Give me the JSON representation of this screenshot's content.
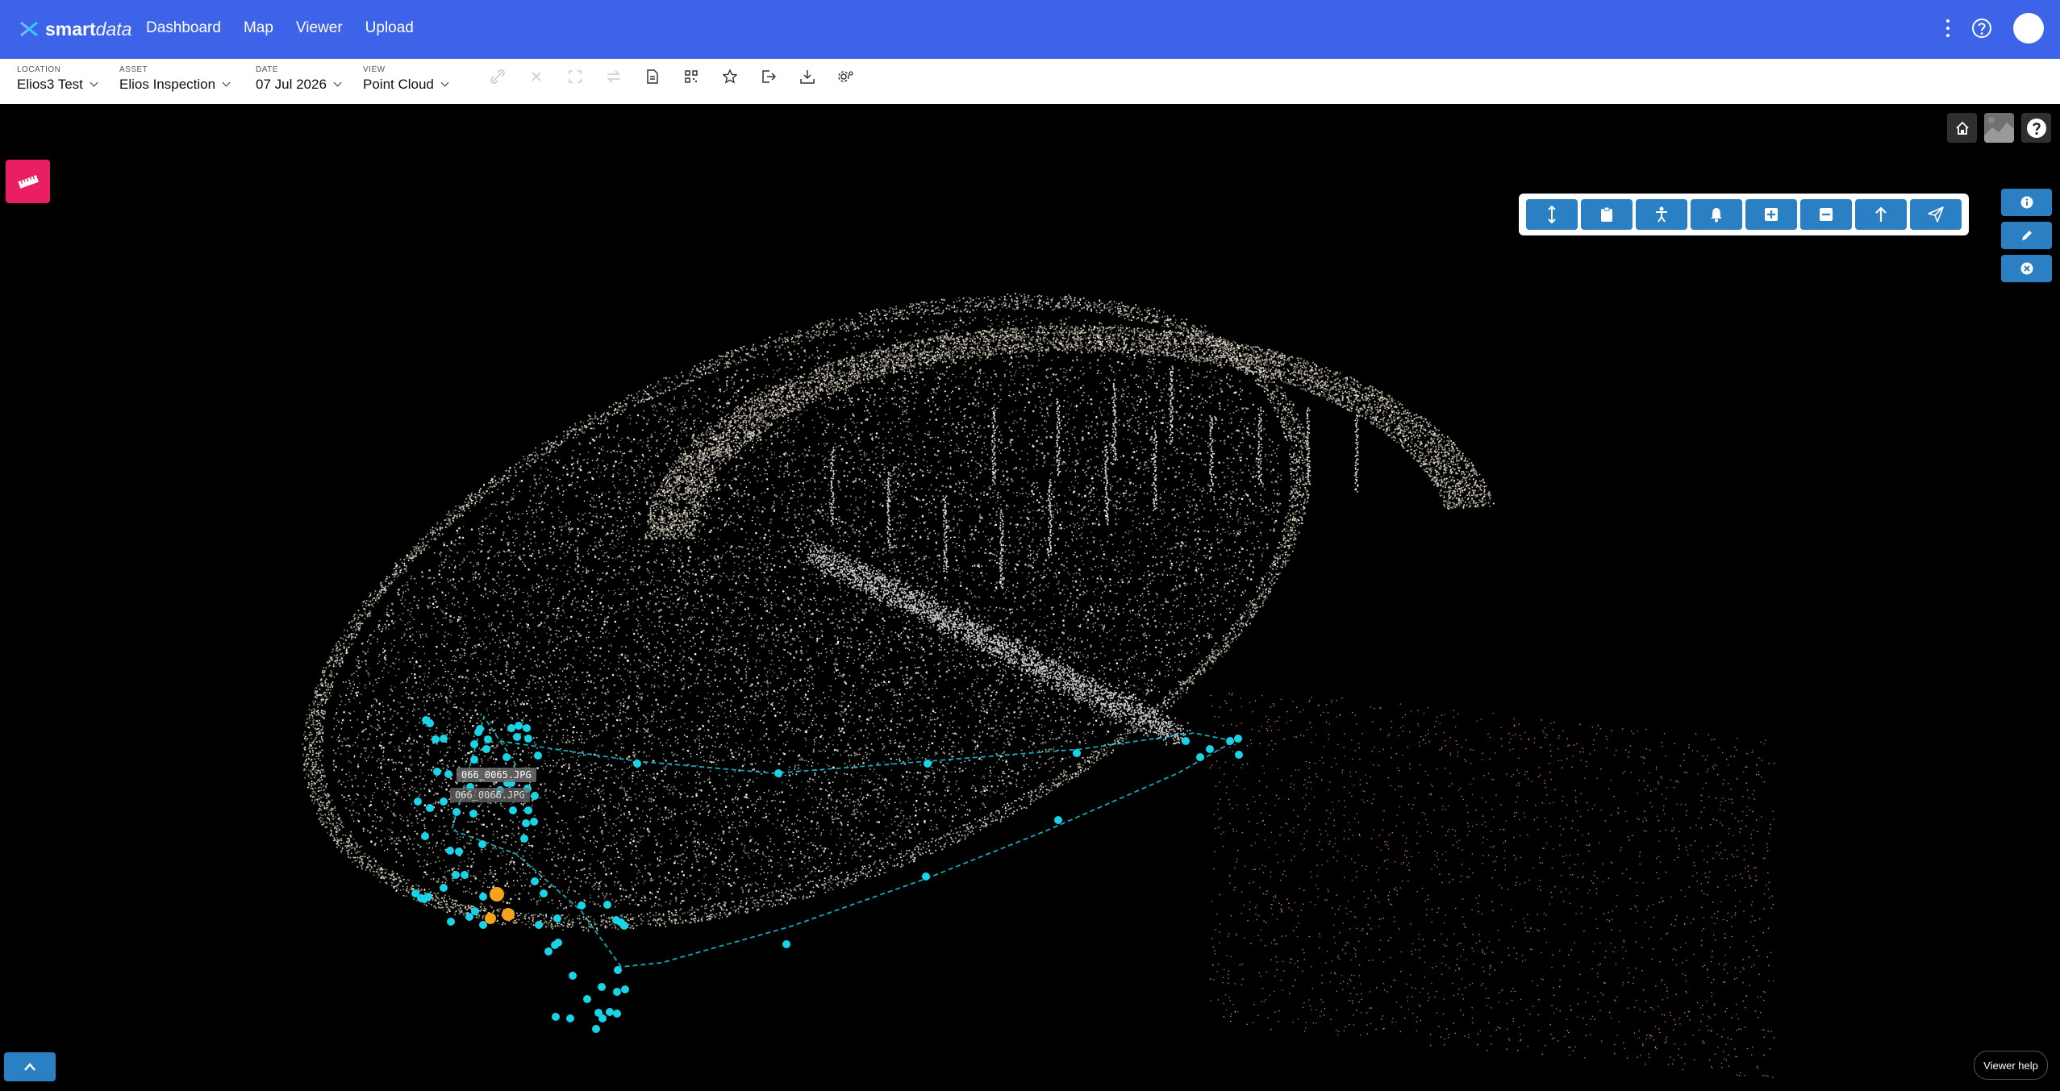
{
  "app": {
    "logo_bold": "smart",
    "logo_light": "data",
    "brand_color": "#3c63e8",
    "icons": [
      "smartdata-logo-icon",
      "kebab-menu-icon",
      "help-icon",
      "user-avatar"
    ]
  },
  "nav": {
    "items": [
      "Dashboard",
      "Map",
      "Viewer",
      "Upload"
    ]
  },
  "filters": {
    "location": {
      "label": "LOCATION",
      "value": "Elios3 Test"
    },
    "asset": {
      "label": "ASSET",
      "value": "Elios Inspection"
    },
    "date": {
      "label": "DATE",
      "value": "07 Jul 2026"
    },
    "view": {
      "label": "VIEW",
      "value": "Point Cloud"
    }
  },
  "toolbar_icons": [
    "unlink-icon",
    "close-icon",
    "expand-icon",
    "swap-icon",
    "document-icon",
    "qr-icon",
    "star-icon",
    "export-icon",
    "download-icon",
    "settings-icon"
  ],
  "viewer": {
    "measure_color": "#e91e63",
    "tool_color": "#2b7fc3",
    "path_color": "#19d3e6",
    "marker_color": "#f7a21b",
    "photo_labels": [
      "066_0065.JPG",
      "066_0066.JPG"
    ],
    "tool_buttons": [
      "height-icon",
      "clipboard-icon",
      "person-icon",
      "bell-icon",
      "plus-square-icon",
      "minus-square-icon",
      "arrow-up-icon",
      "send-icon"
    ],
    "side_buttons": [
      "info-icon",
      "edit-icon",
      "close-circle-icon"
    ],
    "corner_buttons": [
      "home-icon",
      "thumbnail-icon",
      "help-icon"
    ],
    "help_label": "Viewer help"
  }
}
